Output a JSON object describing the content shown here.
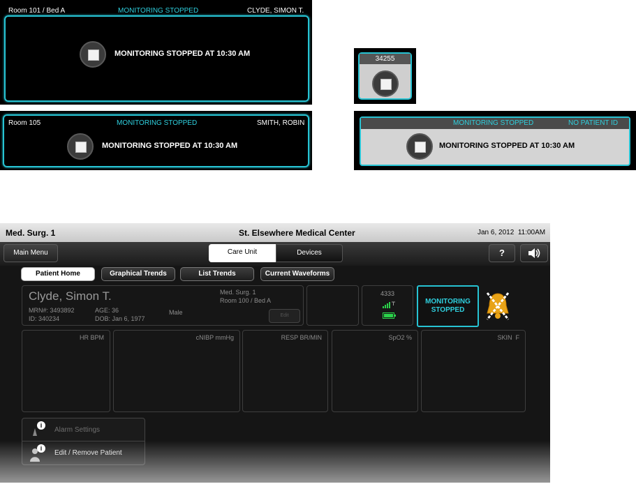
{
  "tiles": {
    "large": {
      "room": "Room 101 / Bed A",
      "status": "MONITORING STOPPED",
      "patient": "CLYDE, SIMON T.",
      "message": "MONITORING STOPPED AT 10:30 AM"
    },
    "mini": {
      "id": "34255"
    },
    "medium": {
      "room": "Room 105",
      "status": "MONITORING STOPPED",
      "patient": "SMITH, ROBIN",
      "message": "MONITORING STOPPED AT 10:30 AM"
    },
    "light": {
      "status": "MONITORING STOPPED",
      "patient": "NO PATIENT ID",
      "message": "MONITORING STOPPED AT 10:30 AM"
    }
  },
  "header": {
    "unit": "Med. Surg. 1",
    "facility": "St. Elsewhere Medical Center",
    "datetime": "Jan 6, 2012  11:00AM"
  },
  "toolbar": {
    "main_menu": "Main Menu",
    "segments": [
      "Care Unit",
      "Devices"
    ],
    "help": "?"
  },
  "tabs": [
    "Patient Home",
    "Graphical Trends",
    "List Trends",
    "Current Waveforms"
  ],
  "patient": {
    "name": "Clyde, Simon T.",
    "mrn": "MRN#: 3493892",
    "id": "ID: 340234",
    "age": "AGE: 36",
    "dob": "DOB: Jan 6, 1977",
    "sex": "Male",
    "unit": "Med. Surg. 1",
    "room": "Room 100 / Bed A",
    "edit": "Edit"
  },
  "device": {
    "id": "4333"
  },
  "status_button": {
    "line1": "MONITORING",
    "line2": "STOPPED"
  },
  "vitals": [
    "HR BPM",
    "cNIBP mmHg",
    "RESP BR/MIN",
    "SpO2 %",
    "SKIN  F"
  ],
  "menu": {
    "alarm": "Alarm Settings",
    "edit_patient": "Edit / Remove Patient"
  },
  "colors": {
    "accent": "#2fd0df",
    "alarm_off": "#e8a317",
    "battery": "#2bd14a"
  }
}
